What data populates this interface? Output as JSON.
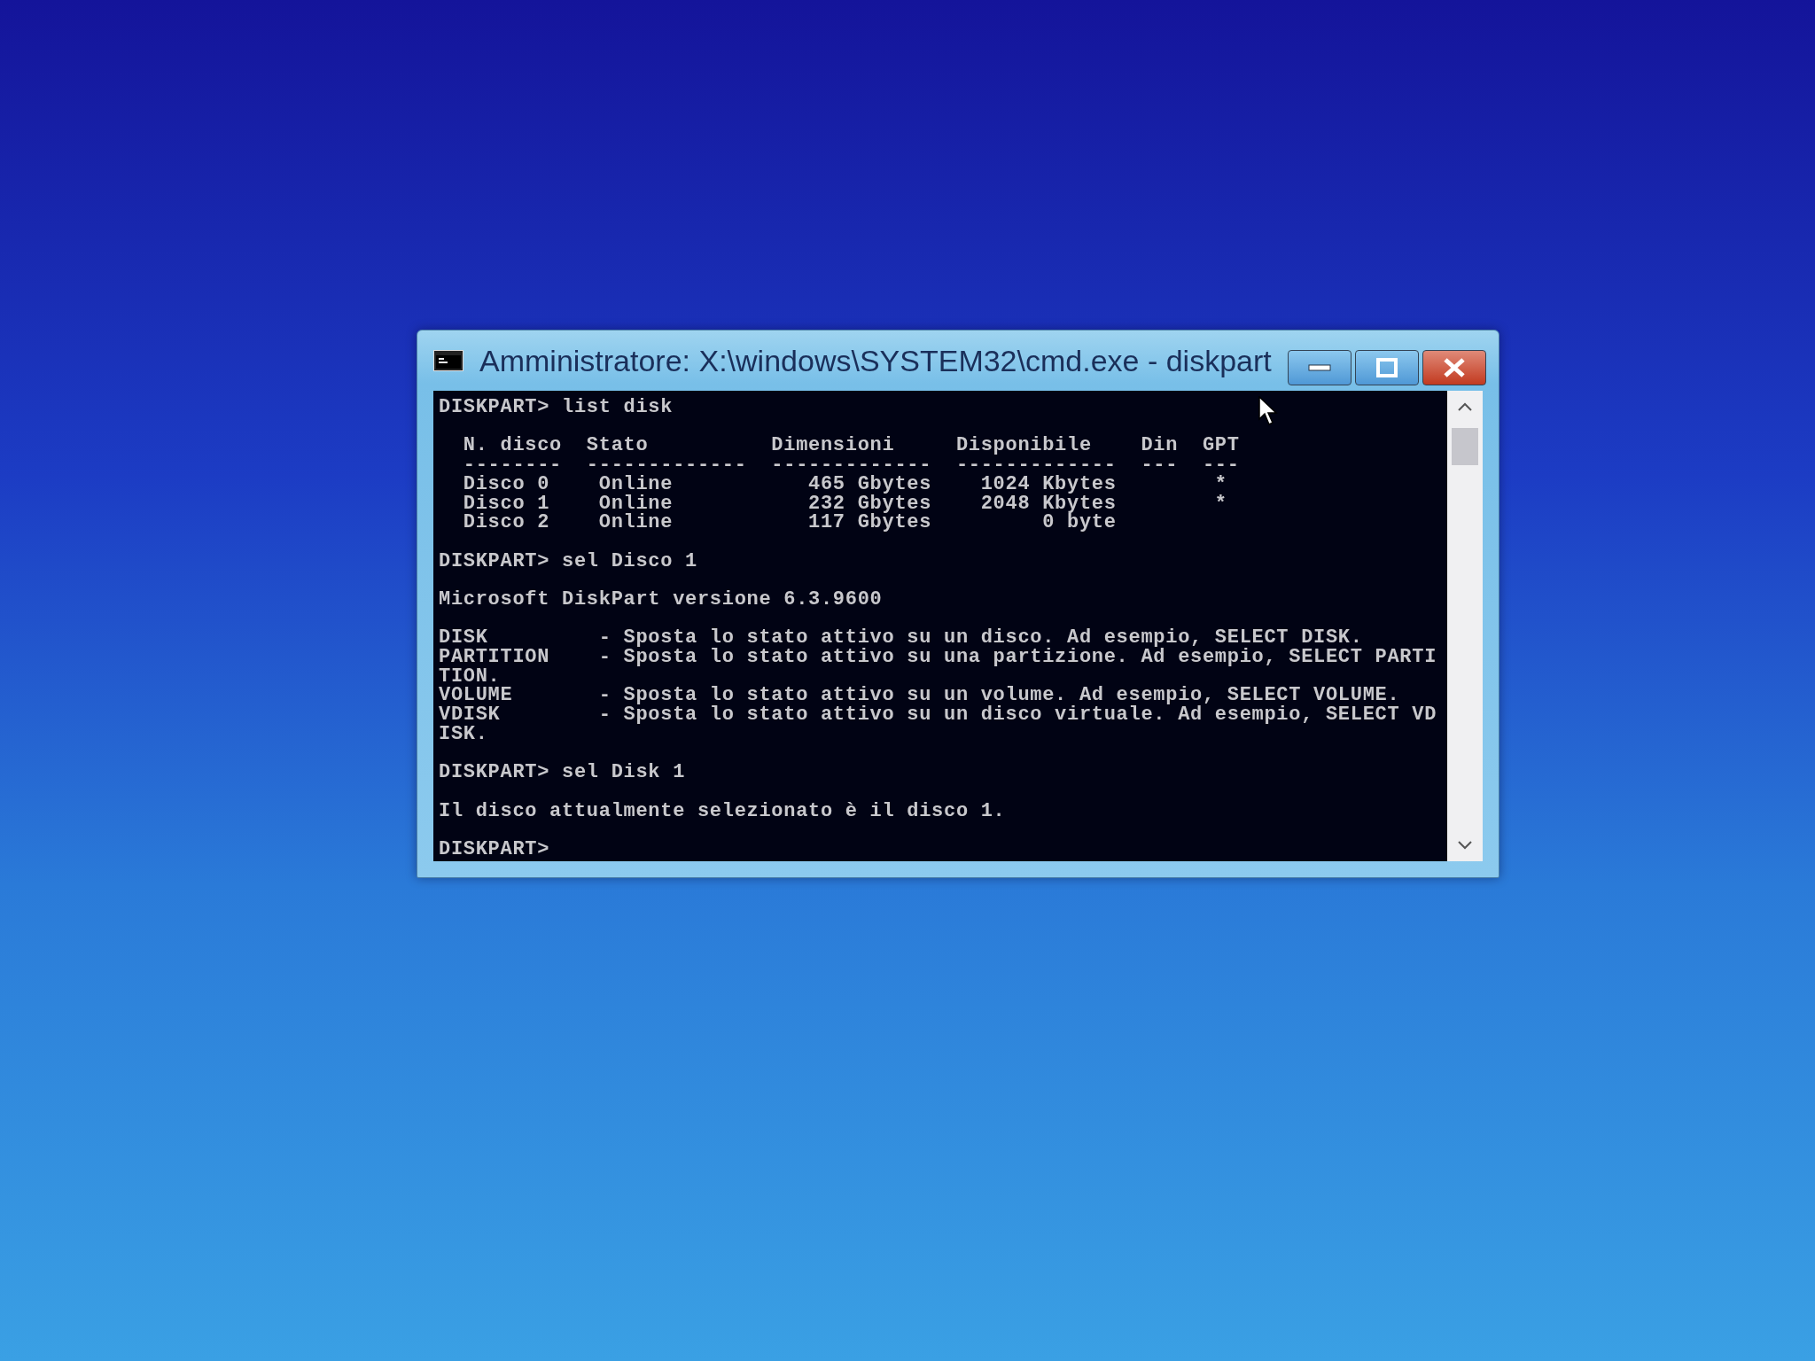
{
  "window": {
    "title": "Amministratore: X:\\windows\\SYSTEM32\\cmd.exe - diskpart"
  },
  "console": {
    "blocks": [
      [
        "DISKPART> list disk"
      ],
      [
        "  N. disco  Stato          Dimensioni     Disponibile    Din  GPT",
        "  --------  -------------  -------------  -------------  ---  ---",
        "  Disco 0    Online           465 Gbytes    1024 Kbytes        *",
        "  Disco 1    Online           232 Gbytes    2048 Kbytes        *",
        "  Disco 2    Online           117 Gbytes         0 byte"
      ],
      [
        "DISKPART> sel Disco 1"
      ],
      [
        "Microsoft DiskPart versione 6.3.9600"
      ],
      [
        "DISK         - Sposta lo stato attivo su un disco. Ad esempio, SELECT DISK.",
        "PARTITION    - Sposta lo stato attivo su una partizione. Ad esempio, SELECT PARTI",
        "TION.",
        "VOLUME       - Sposta lo stato attivo su un volume. Ad esempio, SELECT VOLUME.",
        "VDISK        - Sposta lo stato attivo su un disco virtuale. Ad esempio, SELECT VD",
        "ISK."
      ],
      [
        "DISKPART> sel Disk 1"
      ],
      [
        "Il disco attualmente selezionato è il disco 1."
      ],
      [
        "DISKPART>"
      ]
    ]
  }
}
